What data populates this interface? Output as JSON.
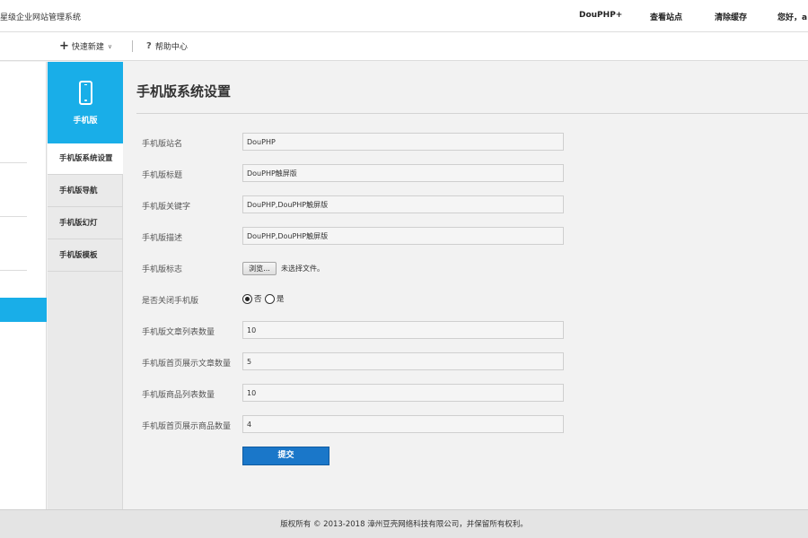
{
  "header": {
    "system_title": "星级企业网站管理系统",
    "links": [
      "DouPHP+",
      "查看站点",
      "清除缓存",
      "您好，a"
    ]
  },
  "toolbar": {
    "quick_new": "快速新建",
    "help": "帮助中心"
  },
  "subnav": {
    "section_title": "手机版",
    "items": [
      "手机版系统设置",
      "手机版导航",
      "手机版幻灯",
      "手机版模板"
    ],
    "active_index": 0
  },
  "page": {
    "title": "手机版系统设置"
  },
  "form": {
    "site_name": {
      "label": "手机版站名",
      "value": "DouPHP"
    },
    "site_title": {
      "label": "手机版标题",
      "value": "DouPHP触屏版"
    },
    "keywords": {
      "label": "手机版关键字",
      "value": "DouPHP,DouPHP触屏版"
    },
    "description": {
      "label": "手机版描述",
      "value": "DouPHP,DouPHP触屏版"
    },
    "logo": {
      "label": "手机版标志",
      "button": "浏览...",
      "status": "未选择文件。"
    },
    "close_mobile": {
      "label": "是否关闭手机版",
      "options": [
        "否",
        "是"
      ],
      "selected": "否"
    },
    "article_list_num": {
      "label": "手机版文章列表数量",
      "value": "10"
    },
    "home_article_num": {
      "label": "手机版首页展示文章数量",
      "value": "5"
    },
    "product_list_num": {
      "label": "手机版商品列表数量",
      "value": "10"
    },
    "home_product_num": {
      "label": "手机版首页展示商品数量",
      "value": "4"
    },
    "submit": "提交"
  },
  "footer": {
    "copyright": "版权所有 © 2013-2018 漳州豆壳网络科技有限公司，并保留所有权利。"
  },
  "colors": {
    "accent": "#19aee8",
    "submit": "#1a77c9"
  }
}
